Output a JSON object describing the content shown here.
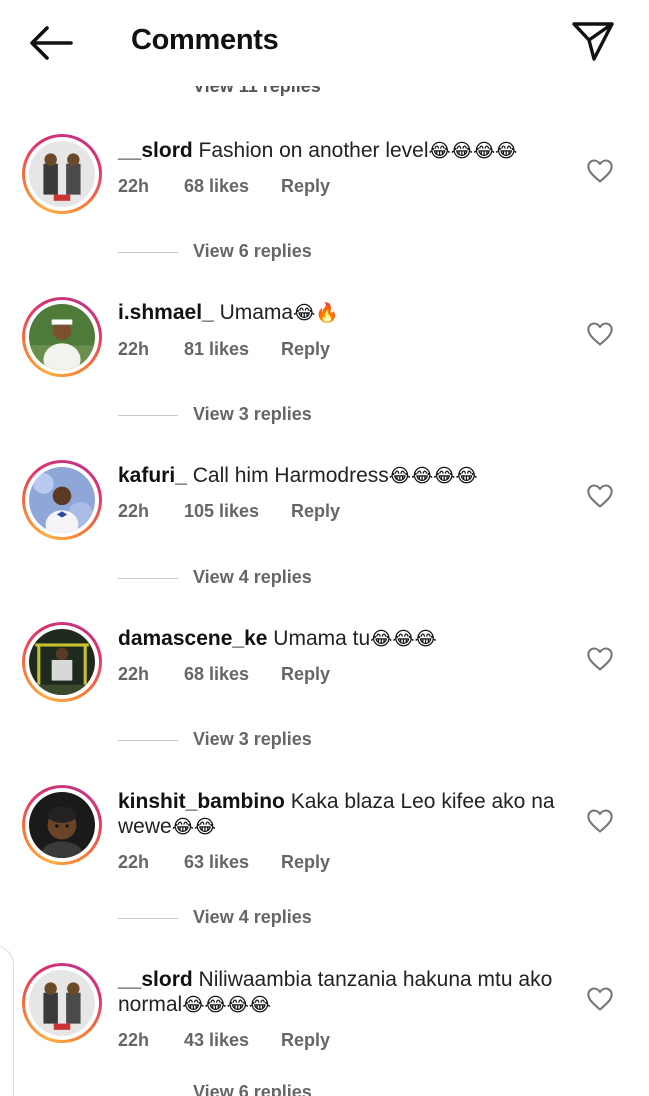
{
  "header": {
    "title": "Comments",
    "back_icon": "arrow-left-icon",
    "share_icon": "send-icon"
  },
  "partial_top_replies": "View 11 replies",
  "comments": [
    {
      "username": "__slord",
      "text": "Fashion on another level",
      "emojis": "😂😂😂😂",
      "time": "22h",
      "likes": "68 likes",
      "reply": "Reply",
      "replies": "View 6 replies"
    },
    {
      "username": "i.shmael_",
      "text": "Umama",
      "emojis": "😂🔥",
      "time": "22h",
      "likes": "81 likes",
      "reply": "Reply",
      "replies": "View 3 replies"
    },
    {
      "username": "kafuri_",
      "text": "Call him Harmodress",
      "emojis": "😂😂😂😂",
      "time": "22h",
      "likes": "105 likes",
      "reply": "Reply",
      "replies": "View 4 replies"
    },
    {
      "username": "damascene_ke",
      "text": "Umama tu",
      "emojis": "😂😂😂",
      "time": "22h",
      "likes": "68 likes",
      "reply": "Reply",
      "replies": "View 3 replies"
    },
    {
      "username": "kinshit_bambino",
      "text": "Kaka blaza Leo kifee ako na wewe",
      "emojis": "😂😂",
      "time": "22h",
      "likes": "63 likes",
      "reply": "Reply",
      "replies": "View 4 replies"
    },
    {
      "username": "__slord",
      "text": "Niliwaambia tanzania hakuna mtu ako normal",
      "emojis": "😂😂😂😂",
      "time": "22h",
      "likes": "43 likes",
      "reply": "Reply",
      "replies": "View 6 replies"
    }
  ],
  "colors": {
    "text": "#111111",
    "meta": "#666666",
    "ring_start": "#fcaf45",
    "ring_end": "#c13584"
  }
}
